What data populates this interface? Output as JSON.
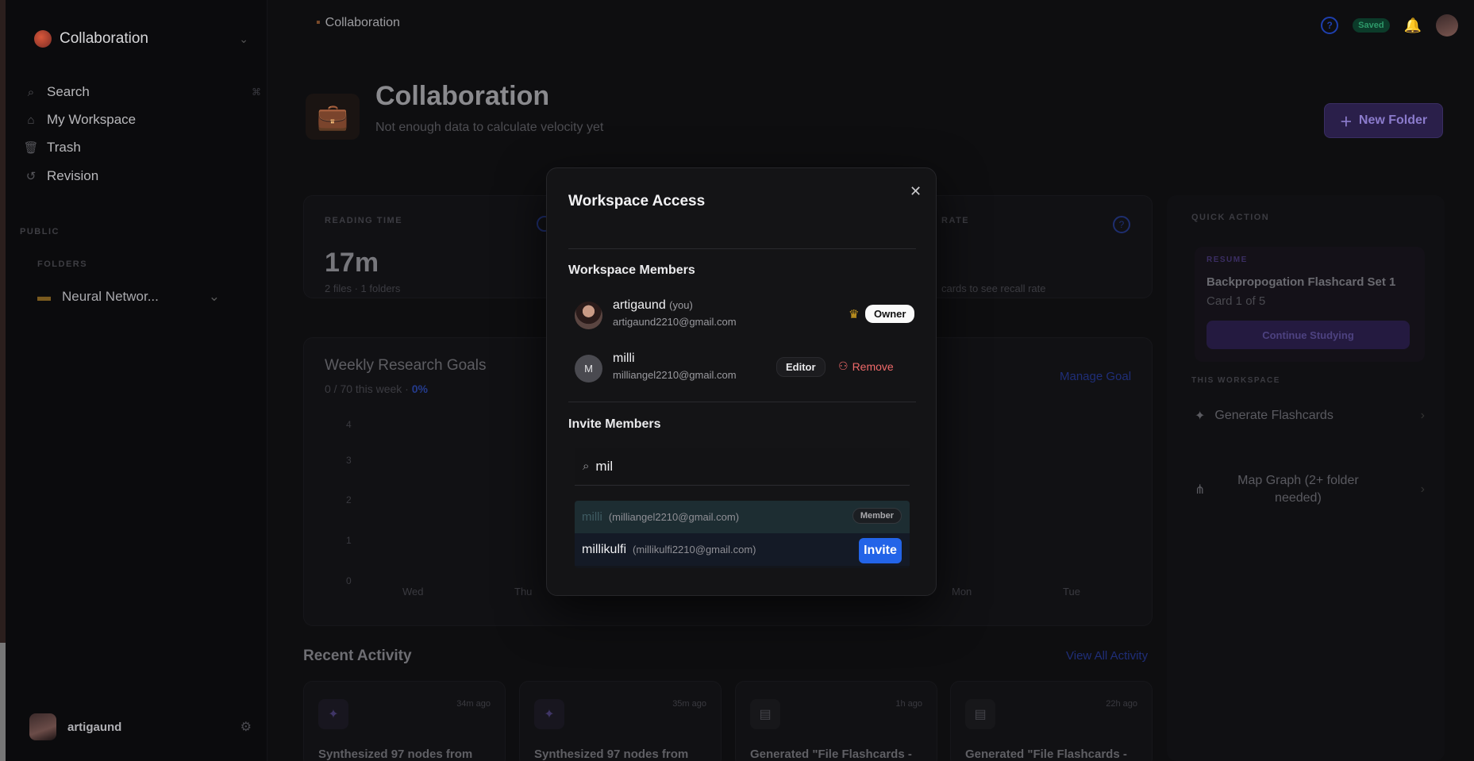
{
  "sidebar": {
    "workspace_name": "Collaboration",
    "nav": [
      {
        "label": "Search",
        "icon": "search-icon"
      },
      {
        "label": "My Workspace",
        "icon": "home-icon"
      },
      {
        "label": "Trash",
        "icon": "trash-icon"
      },
      {
        "label": "Revision",
        "icon": "history-icon"
      }
    ],
    "public_label": "PUBLIC",
    "folders_label": "FOLDERS",
    "folder": "Neural Networ...",
    "user": "artigaund"
  },
  "topbar": {
    "breadcrumb": "Collaboration",
    "saved": "Saved"
  },
  "header": {
    "title": "Collaboration",
    "subtitle": "Not enough data to calculate velocity yet",
    "new_folder": "New Folder"
  },
  "stats": {
    "reading_label": "READING TIME",
    "reading_value": "17m",
    "reading_sub": "2 files · 1 folders",
    "rate_label": "RATE",
    "rate_sub": "cards to see recall rate"
  },
  "goals": {
    "title": "Weekly Research Goals",
    "sub": "0 / 70 this week · ",
    "pct": "0%",
    "manage": "Manage Goal",
    "yticks": [
      "4",
      "3",
      "2",
      "1",
      "0"
    ],
    "xticks": [
      "Wed",
      "Thu",
      "Mon",
      "Tue"
    ]
  },
  "quick": {
    "label": "QUICK ACTION",
    "resume_label": "RESUME",
    "resume_title": "Backpropogation Flashcard Set 1",
    "resume_sub": "Card 1 of 5",
    "continue": "Continue Studying",
    "this_ws": "THIS WORKSPACE",
    "gen": "Generate Flashcards",
    "map": "Map Graph (2+ folder needed)"
  },
  "activity": {
    "title": "Recent Activity",
    "link": "View All Activity",
    "cards": [
      {
        "time": "34m ago",
        "text": "Synthesized 97 nodes from"
      },
      {
        "time": "35m ago",
        "text": "Synthesized 97 nodes from"
      },
      {
        "time": "1h ago",
        "text": "Generated \"File Flashcards -"
      },
      {
        "time": "22h ago",
        "text": "Generated \"File Flashcards -"
      }
    ]
  },
  "modal": {
    "title": "Workspace Access",
    "members_heading": "Workspace Members",
    "members": [
      {
        "name": "artigaund",
        "you": "(you)",
        "email": "artigaund2210@gmail.com",
        "role": "Owner"
      },
      {
        "name": "milli",
        "initial": "M",
        "email": "milliangel2210@gmail.com",
        "role": "Editor",
        "action": "Remove"
      }
    ],
    "invite_heading": "Invite Members",
    "search_value": "mil",
    "results": [
      {
        "name": "milli",
        "email": "(milliangel2210@gmail.com)",
        "tag": "Member"
      },
      {
        "name": "millikulfi",
        "email": "(millikulfi2210@gmail.com)",
        "action": "Invite"
      }
    ]
  }
}
